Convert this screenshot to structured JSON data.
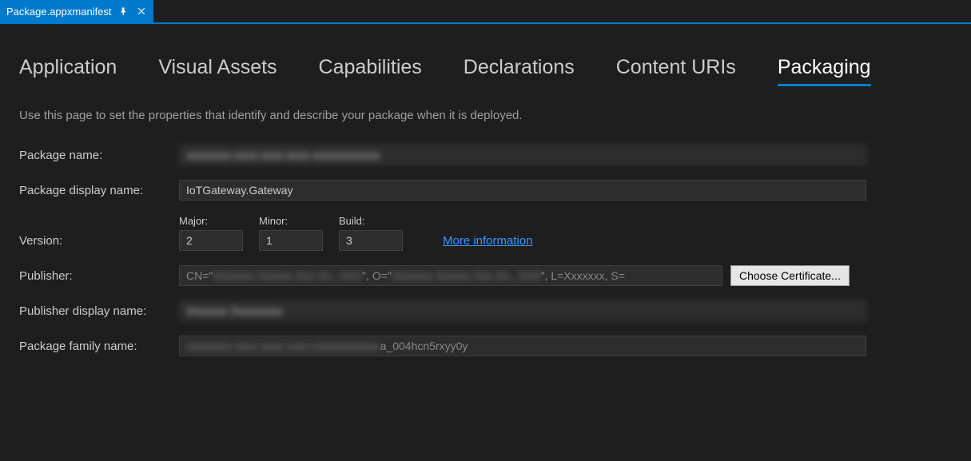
{
  "tab": {
    "title": "Package.appxmanifest"
  },
  "subtabs": {
    "application": "Application",
    "visual_assets": "Visual Assets",
    "capabilities": "Capabilities",
    "declarations": "Declarations",
    "content_uris": "Content URIs",
    "packaging": "Packaging"
  },
  "description": "Use this page to set the properties that identify and describe your package when it is deployed.",
  "labels": {
    "package_name": "Package name:",
    "package_display_name": "Package display name:",
    "version": "Version:",
    "major": "Major:",
    "minor": "Minor:",
    "build": "Build:",
    "more_info": "More information",
    "publisher": "Publisher:",
    "choose_cert": "Choose Certificate...",
    "publisher_display_name": "Publisher display name:",
    "package_family_name": "Package family name:"
  },
  "values": {
    "package_name": "xxxxxxxx-xxxx-xxxx-xxxx-xxxxxxxxxxxx",
    "package_display_name": "IoTGateway.Gateway",
    "major": "2",
    "minor": "1",
    "build": "3",
    "publisher_prefix": "CN=\"",
    "publisher_mid1": "Xxxxxxx Xxxxxx Xxx Xx., XXX",
    "publisher_mid_sep": "\", O=\"",
    "publisher_mid2": "Xxxxxxx Xxxxxx Xxx Xx., XXX",
    "publisher_suffix": "\", L=Xxxxxxx, S=",
    "publisher_display_name": "Xxxxxxx Xxxxxxxxx",
    "family_blur": "xxxxxxxx-xxxx-xxxx-xxxx-xxxxxxxxxxxx",
    "family_suffix": "a_004hcn5rxyy0y"
  }
}
